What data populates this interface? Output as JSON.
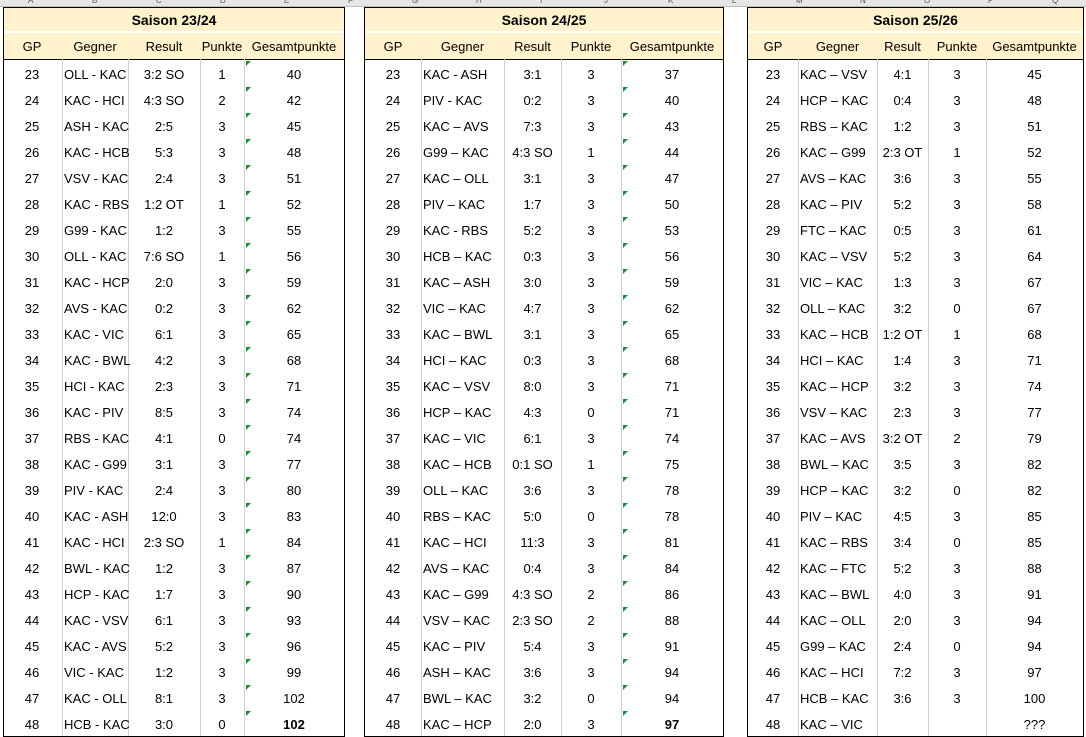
{
  "column_letters": [
    "A",
    "B",
    "C",
    "D",
    "E",
    "F",
    "G",
    "H",
    "I",
    "J",
    "K",
    "L",
    "M",
    "N",
    "O",
    "P",
    "Q"
  ],
  "seasons": [
    {
      "title": "Saison 23/24",
      "headers": {
        "gp": "GP",
        "opp": "Gegner",
        "res": "Result",
        "pk": "Punkte",
        "tot": "Gesamtpunkte"
      },
      "rows": [
        {
          "gp": "23",
          "opp": "OLL - KAC",
          "res": "3:2 SO",
          "pk": "1",
          "tot": "40"
        },
        {
          "gp": "24",
          "opp": "KAC - HCI",
          "res": "4:3 SO",
          "pk": "2",
          "tot": "42"
        },
        {
          "gp": "25",
          "opp": "ASH - KAC",
          "res": "2:5",
          "pk": "3",
          "tot": "45"
        },
        {
          "gp": "26",
          "opp": "KAC - HCB",
          "res": "5:3",
          "pk": "3",
          "tot": "48"
        },
        {
          "gp": "27",
          "opp": "VSV - KAC",
          "res": "2:4",
          "pk": "3",
          "tot": "51"
        },
        {
          "gp": "28",
          "opp": "KAC - RBS",
          "res": "1:2 OT",
          "pk": "1",
          "tot": "52"
        },
        {
          "gp": "29",
          "opp": "G99 - KAC",
          "res": "1:2",
          "pk": "3",
          "tot": "55"
        },
        {
          "gp": "30",
          "opp": "OLL - KAC",
          "res": "7:6 SO",
          "pk": "1",
          "tot": "56"
        },
        {
          "gp": "31",
          "opp": "KAC - HCP",
          "res": "2:0",
          "pk": "3",
          "tot": "59"
        },
        {
          "gp": "32",
          "opp": "AVS - KAC",
          "res": "0:2",
          "pk": "3",
          "tot": "62"
        },
        {
          "gp": "33",
          "opp": "KAC - VIC",
          "res": "6:1",
          "pk": "3",
          "tot": "65"
        },
        {
          "gp": "34",
          "opp": "KAC - BWL",
          "res": "4:2",
          "pk": "3",
          "tot": "68"
        },
        {
          "gp": "35",
          "opp": "HCI - KAC",
          "res": "2:3",
          "pk": "3",
          "tot": "71"
        },
        {
          "gp": "36",
          "opp": "KAC - PIV",
          "res": "8:5",
          "pk": "3",
          "tot": "74"
        },
        {
          "gp": "37",
          "opp": "RBS - KAC",
          "res": "4:1",
          "pk": "0",
          "tot": "74"
        },
        {
          "gp": "38",
          "opp": "KAC - G99",
          "res": "3:1",
          "pk": "3",
          "tot": "77"
        },
        {
          "gp": "39",
          "opp": "PIV - KAC",
          "res": "2:4",
          "pk": "3",
          "tot": "80"
        },
        {
          "gp": "40",
          "opp": "KAC - ASH",
          "res": "12:0",
          "pk": "3",
          "tot": "83"
        },
        {
          "gp": "41",
          "opp": "KAC - HCI",
          "res": "2:3 SO",
          "pk": "1",
          "tot": "84"
        },
        {
          "gp": "42",
          "opp": "BWL - KAC",
          "res": "1:2",
          "pk": "3",
          "tot": "87"
        },
        {
          "gp": "43",
          "opp": "HCP - KAC",
          "res": "1:7",
          "pk": "3",
          "tot": "90"
        },
        {
          "gp": "44",
          "opp": "KAC - VSV",
          "res": "6:1",
          "pk": "3",
          "tot": "93"
        },
        {
          "gp": "45",
          "opp": "KAC - AVS",
          "res": "5:2",
          "pk": "3",
          "tot": "96"
        },
        {
          "gp": "46",
          "opp": "VIC - KAC",
          "res": "1:2",
          "pk": "3",
          "tot": "99"
        },
        {
          "gp": "47",
          "opp": "KAC - OLL",
          "res": "8:1",
          "pk": "3",
          "tot": "102"
        },
        {
          "gp": "48",
          "opp": "HCB - KAC",
          "res": "3:0",
          "pk": "0",
          "tot": "102",
          "bold": true
        }
      ]
    },
    {
      "title": "Saison 24/25",
      "headers": {
        "gp": "GP",
        "opp": "Gegner",
        "res": "Result",
        "pk": "Punkte",
        "tot": "Gesamtpunkte"
      },
      "rows": [
        {
          "gp": "23",
          "opp": "KAC - ASH",
          "res": "3:1",
          "pk": "3",
          "tot": "37"
        },
        {
          "gp": "24",
          "opp": "PIV - KAC",
          "res": "0:2",
          "pk": "3",
          "tot": "40"
        },
        {
          "gp": "25",
          "opp": "KAC – AVS",
          "res": "7:3",
          "pk": "3",
          "tot": "43"
        },
        {
          "gp": "26",
          "opp": "G99 – KAC",
          "res": "4:3 SO",
          "pk": "1",
          "tot": "44"
        },
        {
          "gp": "27",
          "opp": "KAC – OLL",
          "res": "3:1",
          "pk": "3",
          "tot": "47"
        },
        {
          "gp": "28",
          "opp": "PIV – KAC",
          "res": "1:7",
          "pk": "3",
          "tot": "50"
        },
        {
          "gp": "29",
          "opp": "KAC - RBS",
          "res": "5:2",
          "pk": "3",
          "tot": "53"
        },
        {
          "gp": "30",
          "opp": "HCB – KAC",
          "res": "0:3",
          "pk": "3",
          "tot": "56"
        },
        {
          "gp": "31",
          "opp": "KAC – ASH",
          "res": "3:0",
          "pk": "3",
          "tot": "59"
        },
        {
          "gp": "32",
          "opp": "VIC – KAC",
          "res": "4:7",
          "pk": "3",
          "tot": "62"
        },
        {
          "gp": "33",
          "opp": "KAC – BWL",
          "res": "3:1",
          "pk": "3",
          "tot": "65"
        },
        {
          "gp": "34",
          "opp": "HCI – KAC",
          "res": "0:3",
          "pk": "3",
          "tot": "68"
        },
        {
          "gp": "35",
          "opp": "KAC – VSV",
          "res": "8:0",
          "pk": "3",
          "tot": "71"
        },
        {
          "gp": "36",
          "opp": "HCP – KAC",
          "res": "4:3",
          "pk": "0",
          "tot": "71"
        },
        {
          "gp": "37",
          "opp": "KAC – VIC",
          "res": "6:1",
          "pk": "3",
          "tot": "74"
        },
        {
          "gp": "38",
          "opp": "KAC – HCB",
          "res": "0:1 SO",
          "pk": "1",
          "tot": "75"
        },
        {
          "gp": "39",
          "opp": "OLL – KAC",
          "res": "3:6",
          "pk": "3",
          "tot": "78"
        },
        {
          "gp": "40",
          "opp": "RBS – KAC",
          "res": "5:0",
          "pk": "0",
          "tot": "78"
        },
        {
          "gp": "41",
          "opp": "KAC – HCI",
          "res": "11:3",
          "pk": "3",
          "tot": "81"
        },
        {
          "gp": "42",
          "opp": "AVS – KAC",
          "res": "0:4",
          "pk": "3",
          "tot": "84"
        },
        {
          "gp": "43",
          "opp": "KAC – G99",
          "res": "4:3 SO",
          "pk": "2",
          "tot": "86"
        },
        {
          "gp": "44",
          "opp": "VSV – KAC",
          "res": "2:3 SO",
          "pk": "2",
          "tot": "88"
        },
        {
          "gp": "45",
          "opp": "KAC – PIV",
          "res": "5:4",
          "pk": "3",
          "tot": "91"
        },
        {
          "gp": "46",
          "opp": "ASH – KAC",
          "res": "3:6",
          "pk": "3",
          "tot": "94"
        },
        {
          "gp": "47",
          "opp": "BWL – KAC",
          "res": "3:2",
          "pk": "0",
          "tot": "94"
        },
        {
          "gp": "48",
          "opp": "KAC – HCP",
          "res": "2:0",
          "pk": "3",
          "tot": "97",
          "bold": true
        }
      ]
    },
    {
      "title": "Saison 25/26",
      "headers": {
        "gp": "GP",
        "opp": "Gegner",
        "res": "Result",
        "pk": "Punkte",
        "tot": "Gesamtpunkte"
      },
      "rows": [
        {
          "gp": "23",
          "opp": "KAC – VSV",
          "res": "4:1",
          "pk": "3",
          "tot": "45"
        },
        {
          "gp": "24",
          "opp": "HCP – KAC",
          "res": "0:4",
          "pk": "3",
          "tot": "48"
        },
        {
          "gp": "25",
          "opp": "RBS – KAC",
          "res": "1:2",
          "pk": "3",
          "tot": "51"
        },
        {
          "gp": "26",
          "opp": "KAC – G99",
          "res": "2:3 OT",
          "pk": "1",
          "tot": "52"
        },
        {
          "gp": "27",
          "opp": "AVS – KAC",
          "res": "3:6",
          "pk": "3",
          "tot": "55"
        },
        {
          "gp": "28",
          "opp": "KAC – PIV",
          "res": "5:2",
          "pk": "3",
          "tot": "58"
        },
        {
          "gp": "29",
          "opp": "FTC – KAC",
          "res": "0:5",
          "pk": "3",
          "tot": "61"
        },
        {
          "gp": "30",
          "opp": "KAC – VSV",
          "res": "5:2",
          "pk": "3",
          "tot": "64"
        },
        {
          "gp": "31",
          "opp": "VIC – KAC",
          "res": "1:3",
          "pk": "3",
          "tot": "67"
        },
        {
          "gp": "32",
          "opp": "OLL – KAC",
          "res": "3:2",
          "pk": "0",
          "tot": "67"
        },
        {
          "gp": "33",
          "opp": "KAC – HCB",
          "res": "1:2 OT",
          "pk": "1",
          "tot": "68"
        },
        {
          "gp": "34",
          "opp": "HCI – KAC",
          "res": "1:4",
          "pk": "3",
          "tot": "71"
        },
        {
          "gp": "35",
          "opp": "KAC – HCP",
          "res": "3:2",
          "pk": "3",
          "tot": "74"
        },
        {
          "gp": "36",
          "opp": "VSV – KAC",
          "res": "2:3",
          "pk": "3",
          "tot": "77"
        },
        {
          "gp": "37",
          "opp": "KAC – AVS",
          "res": "3:2 OT",
          "pk": "2",
          "tot": "79"
        },
        {
          "gp": "38",
          "opp": "BWL – KAC",
          "res": "3:5",
          "pk": "3",
          "tot": "82"
        },
        {
          "gp": "39",
          "opp": "HCP – KAC",
          "res": "3:2",
          "pk": "0",
          "tot": "82"
        },
        {
          "gp": "40",
          "opp": "PIV – KAC",
          "res": "4:5",
          "pk": "3",
          "tot": "85"
        },
        {
          "gp": "41",
          "opp": "KAC – RBS",
          "res": "3:4",
          "pk": "0",
          "tot": "85"
        },
        {
          "gp": "42",
          "opp": "KAC – FTC",
          "res": "5:2",
          "pk": "3",
          "tot": "88"
        },
        {
          "gp": "43",
          "opp": "KAC – BWL",
          "res": "4:0",
          "pk": "3",
          "tot": "91"
        },
        {
          "gp": "44",
          "opp": "KAC – OLL",
          "res": "2:0",
          "pk": "3",
          "tot": "94"
        },
        {
          "gp": "45",
          "opp": "G99 – KAC",
          "res": "2:4",
          "pk": "0",
          "tot": "94"
        },
        {
          "gp": "46",
          "opp": "KAC – HCI",
          "res": "7:2",
          "pk": "3",
          "tot": "97"
        },
        {
          "gp": "47",
          "opp": "HCB – KAC",
          "res": "3:6",
          "pk": "3",
          "tot": "100"
        },
        {
          "gp": "48",
          "opp": "KAC – VIC",
          "res": "",
          "pk": "",
          "tot": "???"
        }
      ]
    }
  ],
  "colors": {
    "header_fill": "#fff2cc",
    "comment_marker": "#1e8a3a",
    "grid": "#000000"
  }
}
